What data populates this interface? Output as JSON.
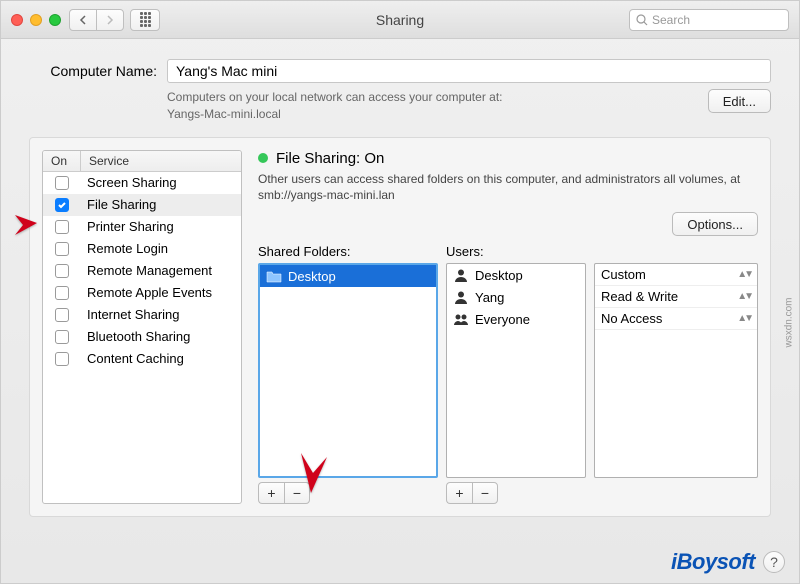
{
  "titlebar": {
    "title": "Sharing",
    "search_placeholder": "Search"
  },
  "computer_name": {
    "label": "Computer Name:",
    "value": "Yang's Mac mini",
    "info_line1": "Computers on your local network can access your computer at:",
    "info_line2": "Yangs-Mac-mini.local",
    "edit_button": "Edit..."
  },
  "services": {
    "header_on": "On",
    "header_service": "Service",
    "items": [
      {
        "label": "Screen Sharing",
        "on": false,
        "selected": false
      },
      {
        "label": "File Sharing",
        "on": true,
        "selected": true
      },
      {
        "label": "Printer Sharing",
        "on": false,
        "selected": false
      },
      {
        "label": "Remote Login",
        "on": false,
        "selected": false
      },
      {
        "label": "Remote Management",
        "on": false,
        "selected": false
      },
      {
        "label": "Remote Apple Events",
        "on": false,
        "selected": false
      },
      {
        "label": "Internet Sharing",
        "on": false,
        "selected": false
      },
      {
        "label": "Bluetooth Sharing",
        "on": false,
        "selected": false
      },
      {
        "label": "Content Caching",
        "on": false,
        "selected": false
      }
    ]
  },
  "detail": {
    "status_label": "File Sharing: On",
    "description": "Other users can access shared folders on this computer, and administrators all volumes, at smb://yangs-mac-mini.lan",
    "options_button": "Options...",
    "shared_folders_label": "Shared Folders:",
    "users_label": "Users:",
    "folders": [
      {
        "label": "Desktop",
        "selected": true
      }
    ],
    "users": [
      {
        "label": "Desktop",
        "icon": "person"
      },
      {
        "label": "Yang",
        "icon": "person"
      },
      {
        "label": "Everyone",
        "icon": "group"
      }
    ],
    "permissions": [
      {
        "label": "Custom"
      },
      {
        "label": "Read & Write"
      },
      {
        "label": "No Access"
      }
    ]
  },
  "brand": "iBoysoft",
  "watermark": "wsxdn.com"
}
